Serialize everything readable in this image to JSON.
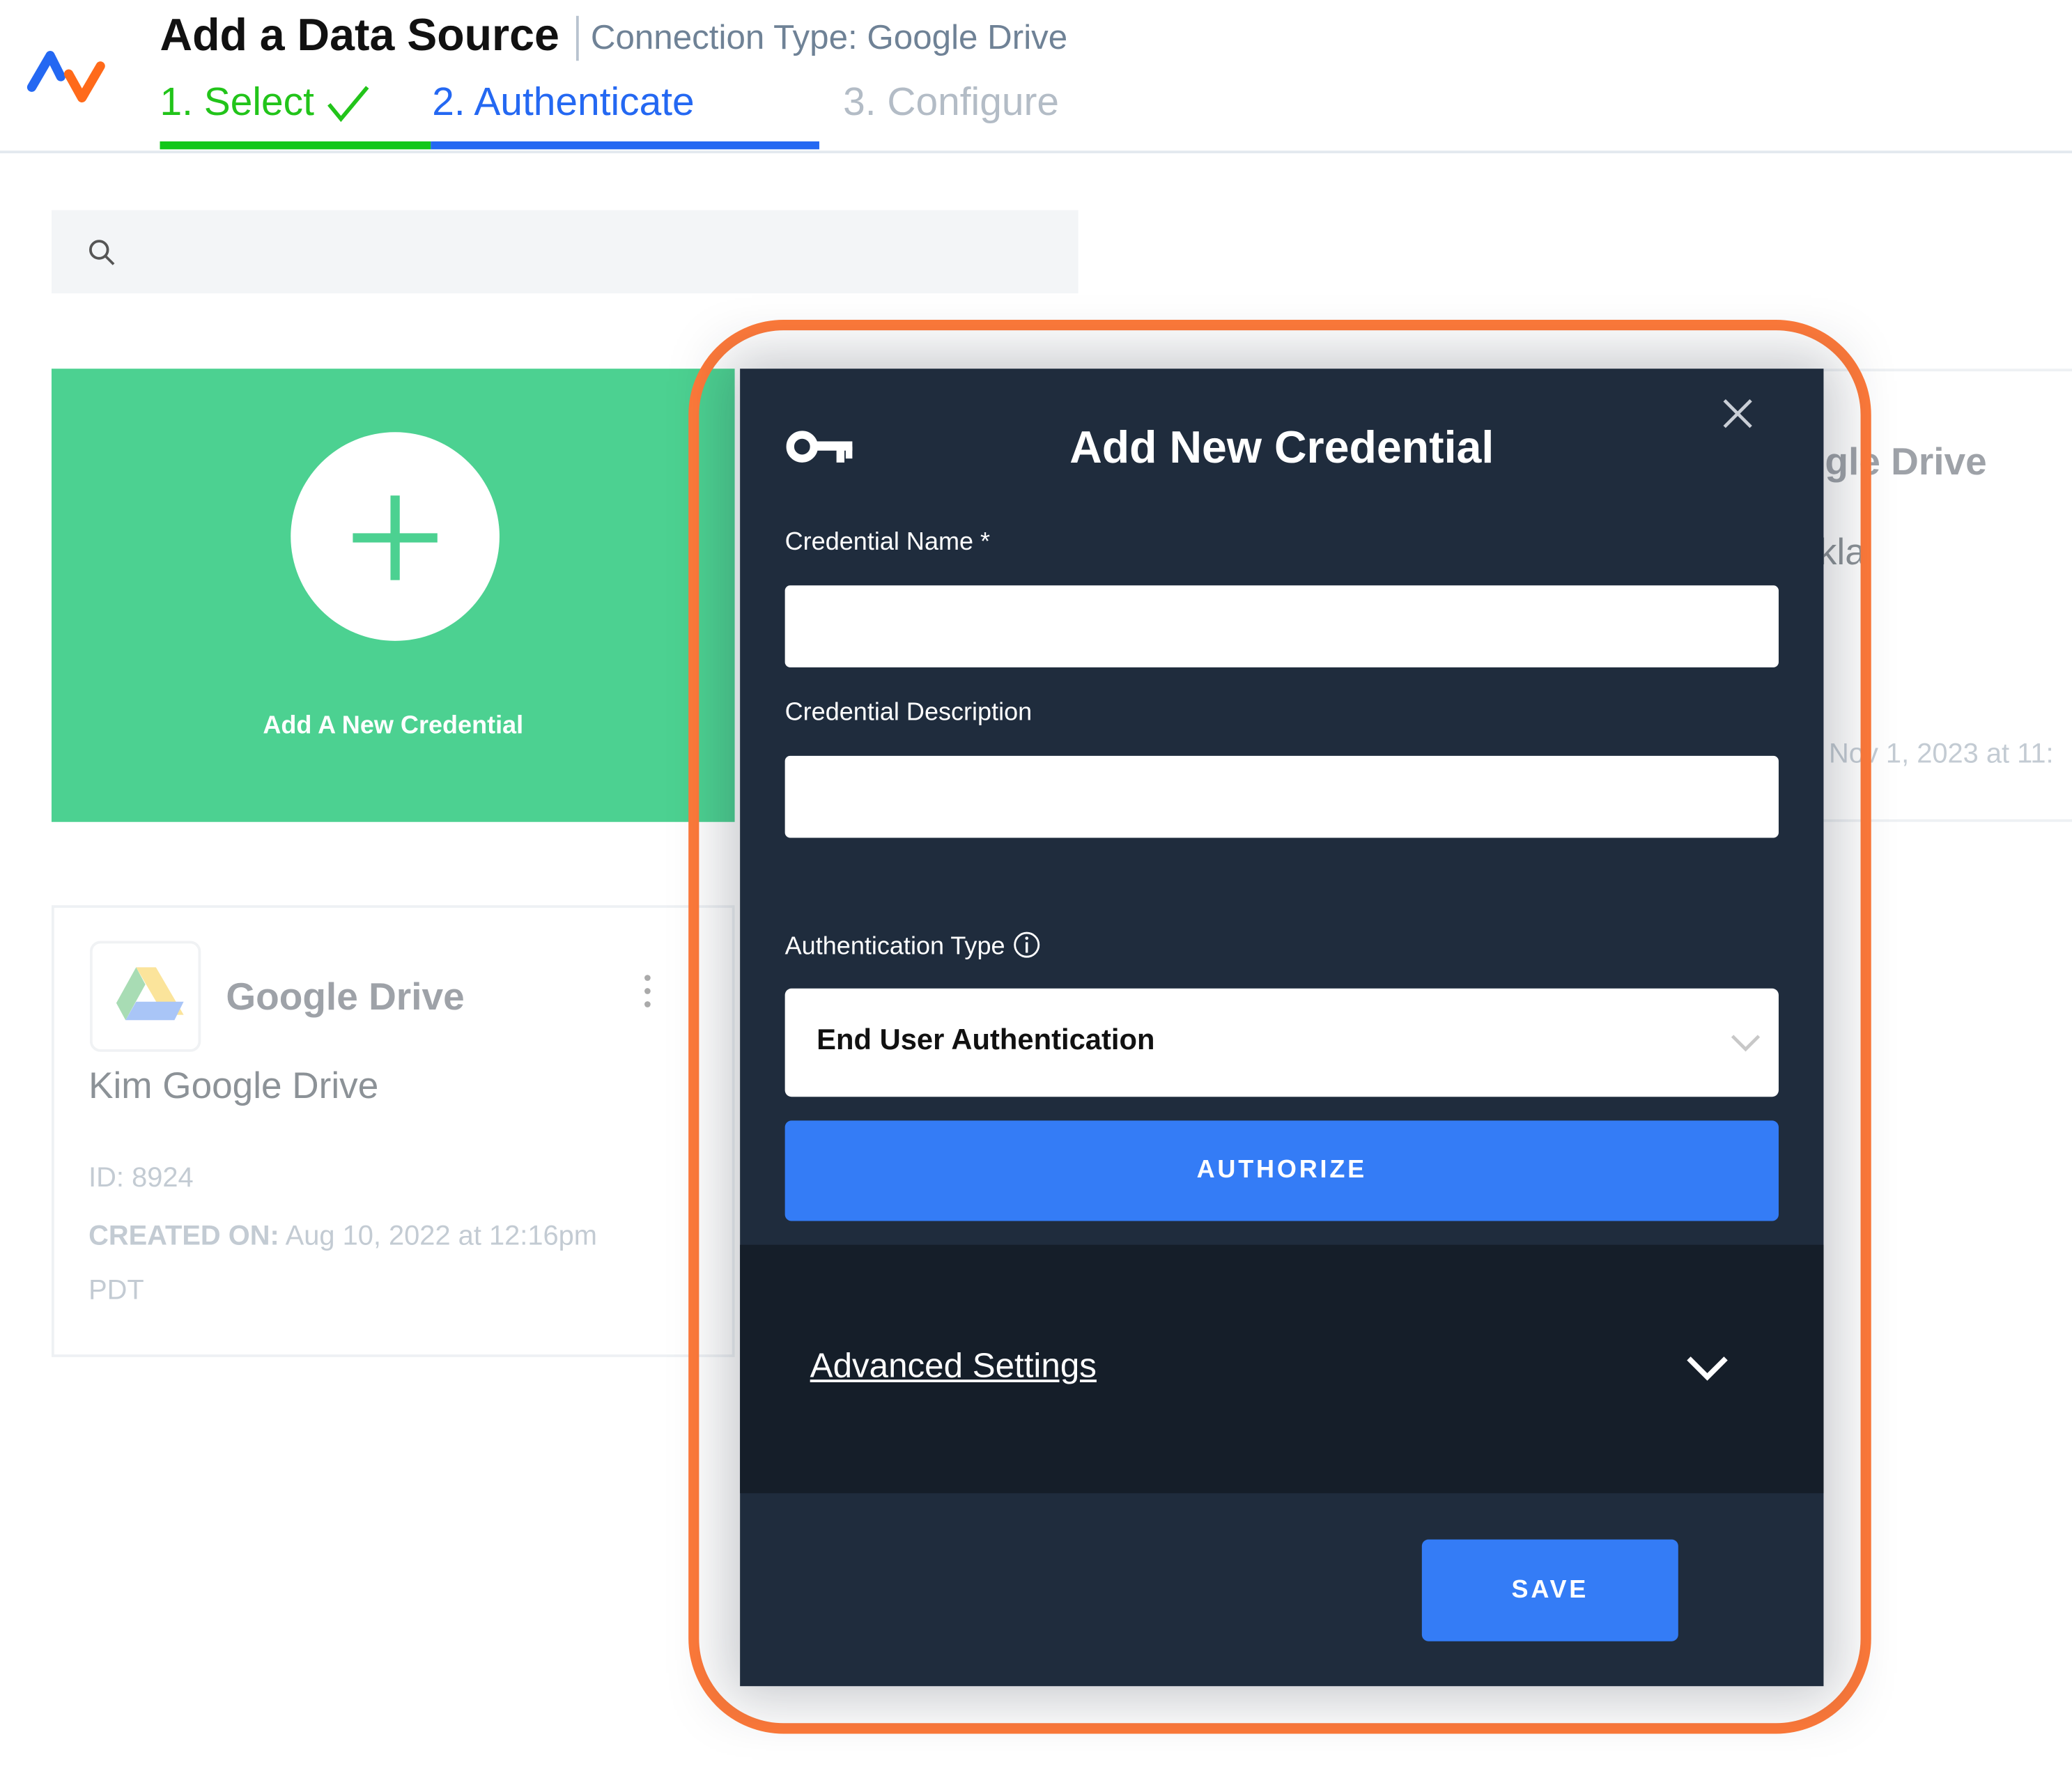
{
  "header": {
    "title": "Add a Data Source",
    "subtitle": "Connection Type: Google Drive",
    "steps": [
      {
        "label": "1. Select",
        "state": "complete"
      },
      {
        "label": "2. Authenticate",
        "state": "active"
      },
      {
        "label": "3. Configure",
        "state": "pending"
      }
    ]
  },
  "search": {
    "placeholder": "",
    "icon": "search-icon"
  },
  "cards": {
    "new_credential_label": "Add A New Credential",
    "existing": [
      {
        "type": "Google Drive",
        "name": "Kim Google Drive",
        "id_label": "ID:",
        "id": "8924",
        "created_label": "CREATED ON:",
        "created": "Aug 10, 2022 at 12:16pm",
        "tz": "PDT"
      }
    ],
    "partial": {
      "type_fragment": "gle Drive",
      "name_fragment": "kla",
      "created_fragment": "Nov 1, 2023 at 11:"
    }
  },
  "modal": {
    "title": "Add New Credential",
    "credential_name_label": "Credential Name *",
    "credential_name_value": "",
    "credential_description_label": "Credential Description",
    "credential_description_value": "",
    "auth_type_label": "Authentication Type",
    "auth_type_value": "End User Authentication",
    "authorize_label": "AUTHORIZE",
    "advanced_label": "Advanced Settings",
    "save_label": "SAVE"
  },
  "colors": {
    "accent_blue": "#347cf6",
    "step_green": "#22c41a",
    "card_green": "#4cd191",
    "modal_bg": "#1f2c3d",
    "highlight_orange": "#ff7a3a"
  }
}
